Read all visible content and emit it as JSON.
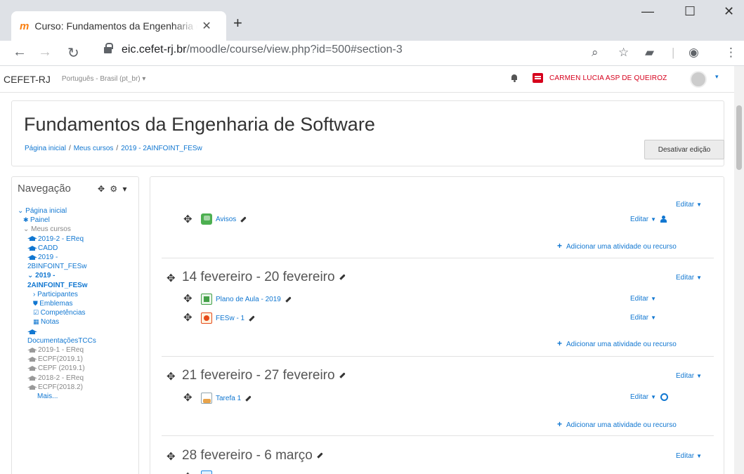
{
  "browser": {
    "tab_title": "Curso: Fundamentos da Engenharia de Software",
    "tab_favicon": "m",
    "close_tab": "✕",
    "new_tab": "+",
    "url_domain": "eic.cefet-rj.br",
    "url_path": "/moodle/course/view.php?id=500#section-3",
    "window_controls": {
      "minimize": "—",
      "maximize": "☐",
      "close": "✕"
    }
  },
  "topbar": {
    "brand": "CEFET-RJ",
    "language": "Português - Brasil (pt_br) ▾",
    "user_name": "CARMEN LUCIA ASP DE QUEIROZ",
    "user_caret": "▾",
    "accent_color": "#d6001c"
  },
  "header": {
    "course_title": "Fundamentos da Engenharia de Software",
    "breadcrumb": [
      "Página inicial",
      "Meus cursos",
      "2019 - 2AINFOINT_FESw"
    ],
    "breadcrumb_sep": "/",
    "edit_mode_button": "Desativar edição"
  },
  "navigation": {
    "title": "Navegação",
    "controls": "✥ ⚙ ▾",
    "items": [
      {
        "label": "⌄ Página inicial",
        "kind": "link"
      },
      {
        "label": "Painel",
        "kind": "link",
        "icon": "dashboard-icon"
      },
      {
        "label": "⌄ Meus cursos",
        "kind": "dim"
      },
      {
        "label": "2019-2 - EReq",
        "kind": "course"
      },
      {
        "label": "CADD",
        "kind": "course"
      },
      {
        "label": "2019 -",
        "kind": "course"
      },
      {
        "label": "2BINFOINT_FESw",
        "kind": "link"
      },
      {
        "label": "⌄ 2019 -",
        "kind": "current"
      },
      {
        "label": "2AINFOINT_FESw",
        "kind": "current"
      },
      {
        "label": "› Participantes",
        "kind": "link"
      },
      {
        "label": "Emblemas",
        "kind": "link",
        "icon": "badge-icon"
      },
      {
        "label": "Competências",
        "kind": "link",
        "icon": "checkbox-icon"
      },
      {
        "label": "Notas",
        "kind": "link",
        "icon": "grid-icon"
      },
      {
        "label": "",
        "kind": "course"
      },
      {
        "label": "DocumentaçõesTCCs",
        "kind": "link"
      },
      {
        "label": "2019-1 - EReq",
        "kind": "past"
      },
      {
        "label": "ECPF(2019.1)",
        "kind": "past"
      },
      {
        "label": "CEPF (2019.1)",
        "kind": "past"
      },
      {
        "label": "2018-2 - EReq",
        "kind": "past"
      },
      {
        "label": "ECPF(2018.2)",
        "kind": "past"
      },
      {
        "label": "Mais...",
        "kind": "link"
      }
    ]
  },
  "sections": [
    {
      "name": "",
      "edit": "Editar",
      "activities": [
        {
          "name": "Avisos",
          "icon": "forum-icon",
          "edit": "Editar",
          "extra": "person-icon"
        }
      ],
      "add": "Adicionar uma atividade ou recurso"
    },
    {
      "name": "14 fevereiro - 20 fevereiro",
      "edit": "Editar",
      "activities": [
        {
          "name": "Plano de Aula - 2019",
          "icon": "spreadsheet-icon",
          "edit": "Editar",
          "extra": ""
        },
        {
          "name": "FESw - 1",
          "icon": "presentation-icon",
          "edit": "Editar",
          "extra": ""
        }
      ],
      "add": "Adicionar uma atividade ou recurso"
    },
    {
      "name": "21 fevereiro - 27 fevereiro",
      "edit": "Editar",
      "activities": [
        {
          "name": "Tarefa 1",
          "icon": "assignment-icon",
          "edit": "Editar",
          "extra": "group-icon"
        }
      ],
      "add": "Adicionar uma atividade ou recurso"
    },
    {
      "name": "28 fevereiro - 6 março",
      "edit": "Editar",
      "activities": [],
      "add": ""
    }
  ],
  "colors": {
    "link": "#1177d1",
    "text": "#333333",
    "border": "#e2e2e2",
    "tabstrip": "#dee1e6"
  }
}
